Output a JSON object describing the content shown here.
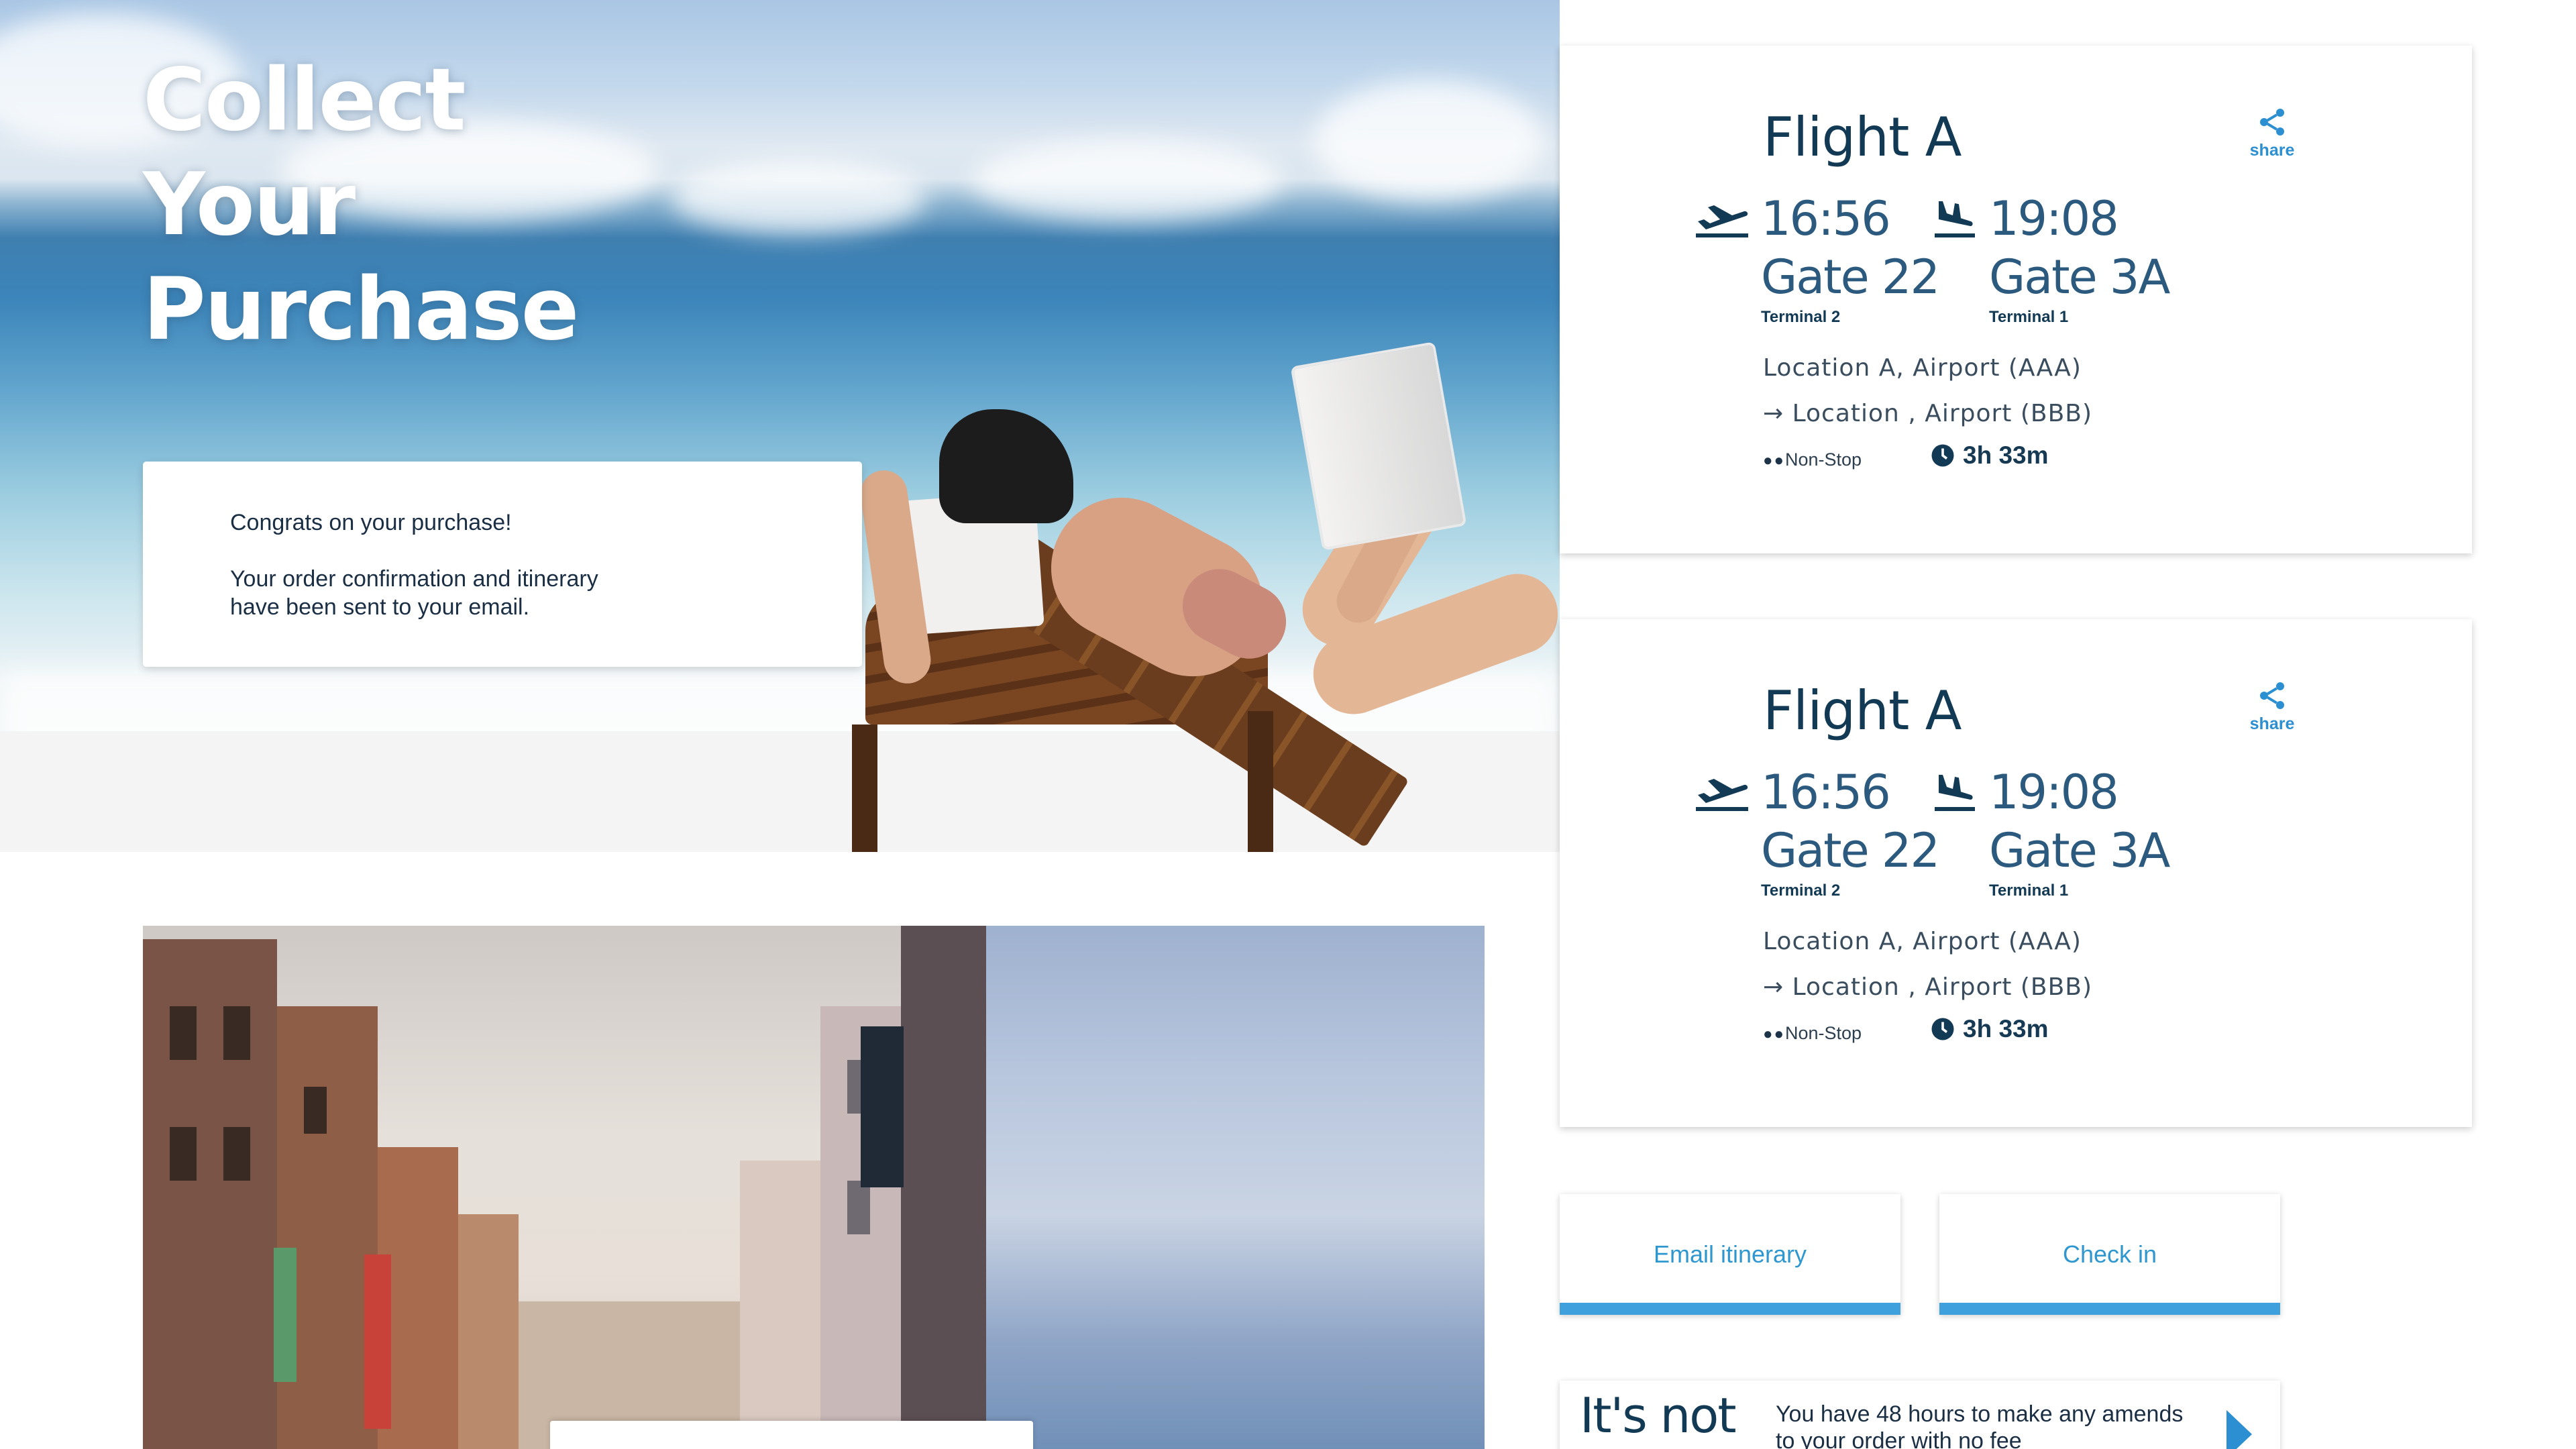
{
  "hero": {
    "title_line1": "Collect",
    "title_line2": "Your",
    "title_line3": "Purchase"
  },
  "confirmation": {
    "heading": "Congrats on your purchase!",
    "message": "Your order confirmation and itinerary have been sent to your email."
  },
  "flights": [
    {
      "name": "Flight A",
      "share_label": "share",
      "departure_time": "16:56",
      "departure_gate": "Gate 22",
      "departure_terminal": "Terminal 2",
      "arrival_time": "19:08",
      "arrival_gate": "Gate 3A",
      "arrival_terminal": "Terminal 1",
      "origin": "Location A, Airport (AAA)",
      "destination": "→ Location , Airport (BBB)",
      "stops": "Non-Stop",
      "duration": "3h 33m"
    },
    {
      "name": "Flight A",
      "share_label": "share",
      "departure_time": "16:56",
      "departure_gate": "Gate 22",
      "departure_terminal": "Terminal 2",
      "arrival_time": "19:08",
      "arrival_gate": "Gate 3A",
      "arrival_terminal": "Terminal 1",
      "origin": "Location A, Airport (AAA)",
      "destination": "→ Location , Airport (BBB)",
      "stops": "Non-Stop",
      "duration": "3h 33m"
    }
  ],
  "actions": {
    "email_label": "Email itinerary",
    "checkin_label": "Check in"
  },
  "notice": {
    "title": "It's not",
    "text": "You have 48 hours to make any amends to your order with no fee"
  },
  "icons": {
    "share": "share-icon",
    "takeoff": "plane-takeoff-icon",
    "landing": "plane-landing-icon",
    "duration": "clock-icon",
    "next": "chevron-right-icon"
  },
  "colors": {
    "accent": "#3ea0dc",
    "heading": "#133a55"
  }
}
